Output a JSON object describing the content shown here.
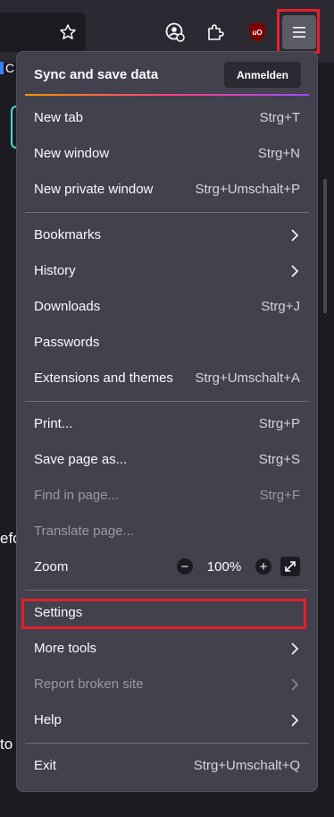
{
  "toolbar": {
    "icons": [
      "star-icon",
      "account-icon",
      "extensions-icon",
      "ublock-icon",
      "menu-icon"
    ],
    "ublock_text": "uO"
  },
  "background": {
    "bookmark_fragment": "C",
    "text_fragment_1": "efo",
    "text_fragment_2": "to"
  },
  "menu": {
    "sync_title": "Sync and save data",
    "signin_label": "Anmelden",
    "items": {
      "new_tab": {
        "label": "New tab",
        "shortcut": "Strg+T"
      },
      "new_window": {
        "label": "New window",
        "shortcut": "Strg+N"
      },
      "new_private_window": {
        "label": "New private window",
        "shortcut": "Strg+Umschalt+P"
      },
      "bookmarks": {
        "label": "Bookmarks"
      },
      "history": {
        "label": "History"
      },
      "downloads": {
        "label": "Downloads",
        "shortcut": "Strg+J"
      },
      "passwords": {
        "label": "Passwords"
      },
      "extensions": {
        "label": "Extensions and themes",
        "shortcut": "Strg+Umschalt+A"
      },
      "print": {
        "label": "Print...",
        "shortcut": "Strg+P"
      },
      "save_page": {
        "label": "Save page as...",
        "shortcut": "Strg+S"
      },
      "find": {
        "label": "Find in page...",
        "shortcut": "Strg+F"
      },
      "translate": {
        "label": "Translate page..."
      },
      "zoom": {
        "label": "Zoom",
        "minus": "−",
        "value": "100%",
        "plus": "+"
      },
      "settings": {
        "label": "Settings"
      },
      "more_tools": {
        "label": "More tools"
      },
      "report": {
        "label": "Report broken site"
      },
      "help": {
        "label": "Help"
      },
      "exit": {
        "label": "Exit",
        "shortcut": "Strg+Umschalt+Q"
      }
    }
  },
  "colors": {
    "panel": "#42414d",
    "highlight": "#e5202c",
    "toolbar": "#2b2a33"
  }
}
